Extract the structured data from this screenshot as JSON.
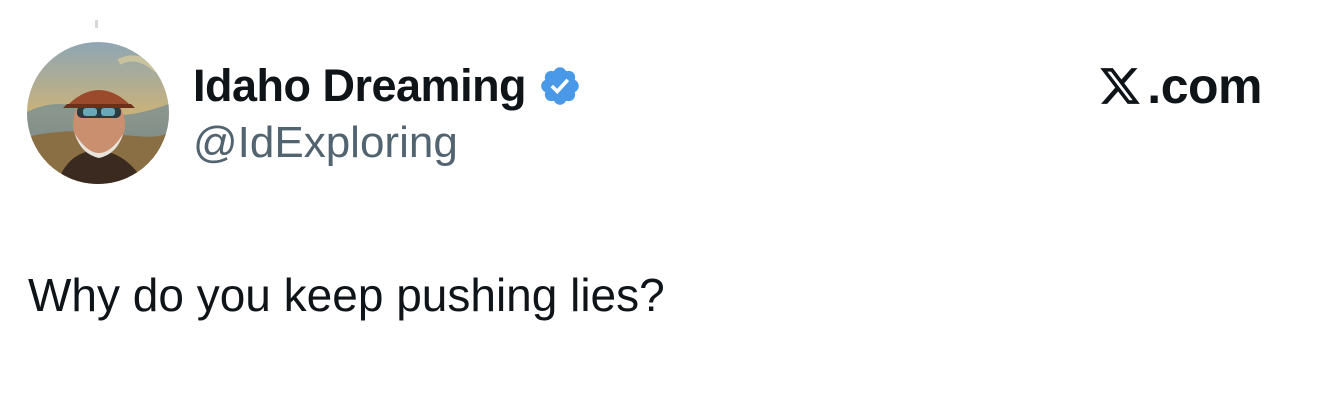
{
  "author": {
    "display_name": "Idaho Dreaming",
    "handle": "@IdExploring",
    "verified": true,
    "avatar_icon": "user-avatar-photo",
    "verified_icon": "verified-badge-icon",
    "verified_color": "#4a99e9"
  },
  "brand": {
    "icon": "x-logo-icon",
    "label": ".com"
  },
  "tweet": {
    "text": "Why do you keep pushing lies?"
  }
}
